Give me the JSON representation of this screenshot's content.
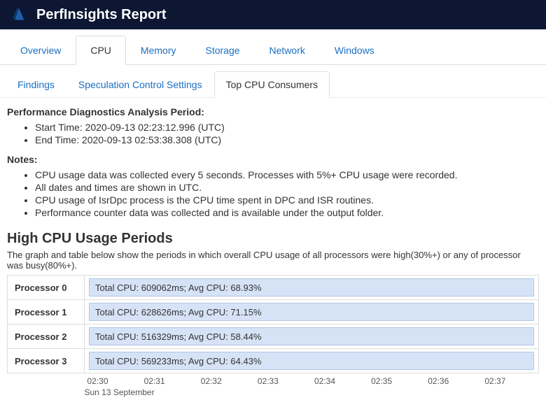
{
  "header": {
    "title": "PerfInsights Report"
  },
  "tabs": [
    {
      "label": "Overview",
      "active": false
    },
    {
      "label": "CPU",
      "active": true
    },
    {
      "label": "Memory",
      "active": false
    },
    {
      "label": "Storage",
      "active": false
    },
    {
      "label": "Network",
      "active": false
    },
    {
      "label": "Windows",
      "active": false
    }
  ],
  "subtabs": [
    {
      "label": "Findings",
      "active": false
    },
    {
      "label": "Speculation Control Settings",
      "active": false
    },
    {
      "label": "Top CPU Consumers",
      "active": true
    }
  ],
  "period": {
    "heading": "Performance Diagnostics Analysis Period:",
    "start": "Start Time: 2020-09-13 02:23:12.996 (UTC)",
    "end": "End Time: 2020-09-13 02:53:38.308 (UTC)"
  },
  "notes": {
    "heading": "Notes:",
    "items": [
      "CPU usage data was collected every 5 seconds. Processes with 5%+ CPU usage were recorded.",
      "All dates and times are shown in UTC.",
      "CPU usage of IsrDpc process is the CPU time spent in DPC and ISR routines.",
      "Performance counter data was collected and is available under the output folder."
    ]
  },
  "highcpu": {
    "heading": "High CPU Usage Periods",
    "desc": "The graph and table below show the periods in which overall CPU usage of all processors were high(30%+) or any of processor was busy(80%+)."
  },
  "chart_data": {
    "type": "bar",
    "title": "High CPU Usage Periods",
    "xlabel": "",
    "ylabel": "",
    "ylim": [
      0,
      100
    ],
    "categories": [
      "Processor 0",
      "Processor 1",
      "Processor 2",
      "Processor 3"
    ],
    "series": [
      {
        "name": "Avg CPU %",
        "values": [
          68.93,
          71.15,
          58.44,
          64.43
        ]
      },
      {
        "name": "Total CPU ms",
        "values": [
          609062,
          628626,
          516329,
          569233
        ]
      }
    ],
    "bar_labels": [
      "Total CPU: 609062ms; Avg CPU: 68.93%",
      "Total CPU: 628626ms; Avg CPU: 71.15%",
      "Total CPU: 516329ms; Avg CPU: 58.44%",
      "Total CPU: 569233ms; Avg CPU: 64.43%"
    ],
    "x_ticks": [
      "02:30",
      "02:31",
      "02:32",
      "02:33",
      "02:34",
      "02:35",
      "02:36",
      "02:37"
    ],
    "x_date": "Sun 13 September"
  }
}
